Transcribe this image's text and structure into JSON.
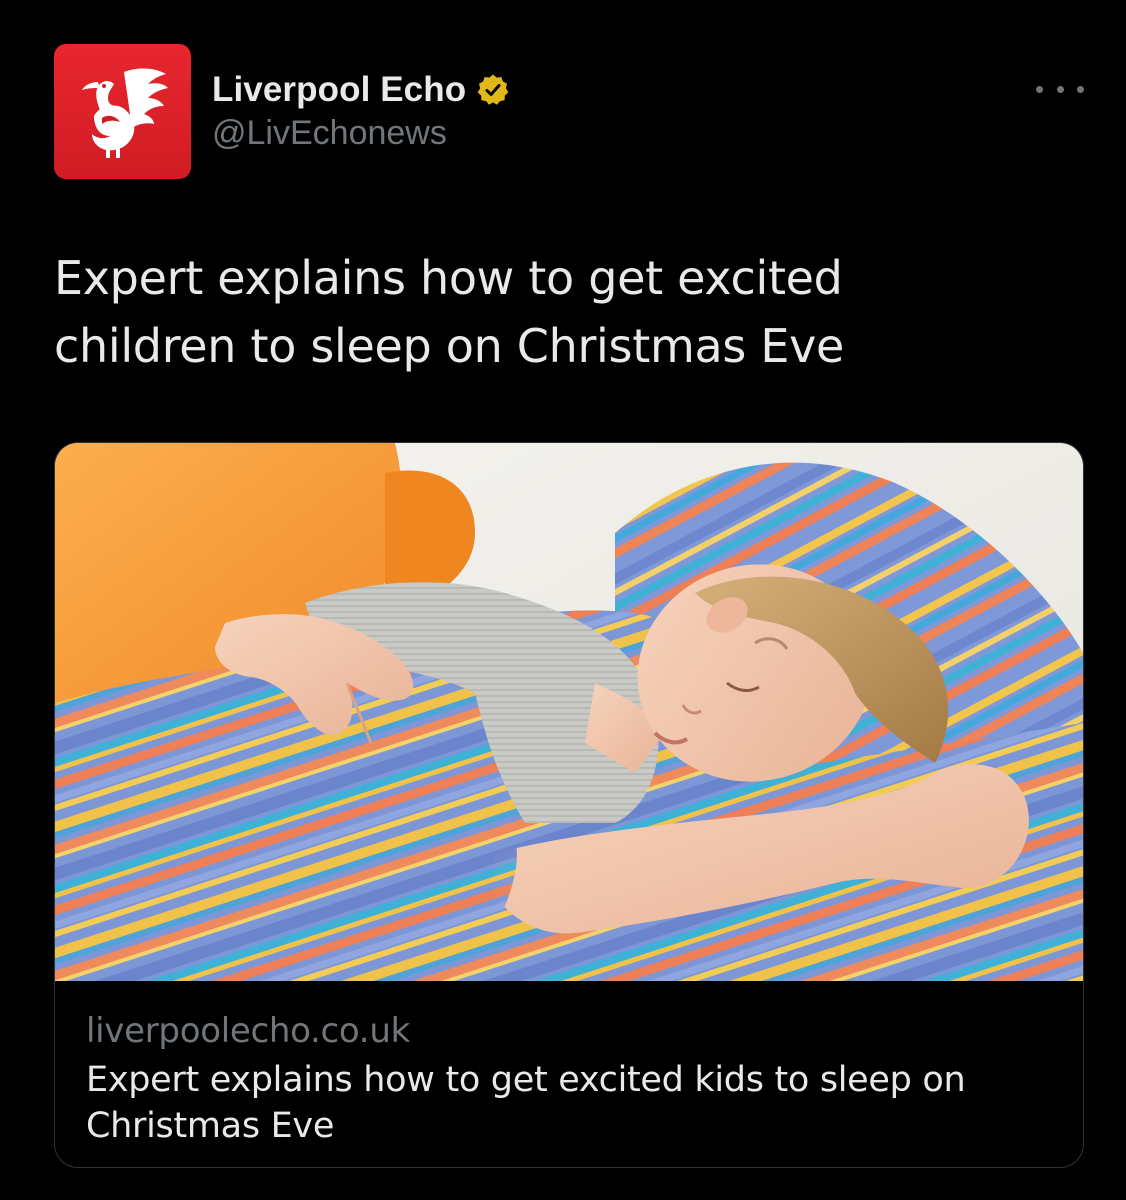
{
  "tweet": {
    "author": {
      "name": "Liverpool Echo",
      "handle": "@LivEchonews",
      "verified": true,
      "avatar_icon": "liver-bird-logo",
      "avatar_color": "#e8262e"
    },
    "more_icon": "more-horizontal-icon",
    "text": "Expert explains how to get excited children to sleep on Christmas Eve",
    "card": {
      "image": "child-sleeping-under-striped-duvet",
      "domain": "liverpoolecho.co.uk",
      "title": "Expert explains how to get excited kids to sleep on Christmas Eve"
    }
  },
  "colors": {
    "background": "#000000",
    "primary_text": "#e7e9ea",
    "secondary_text": "#71767b",
    "border": "#2f3336",
    "verified_badge": "#e2b719"
  }
}
